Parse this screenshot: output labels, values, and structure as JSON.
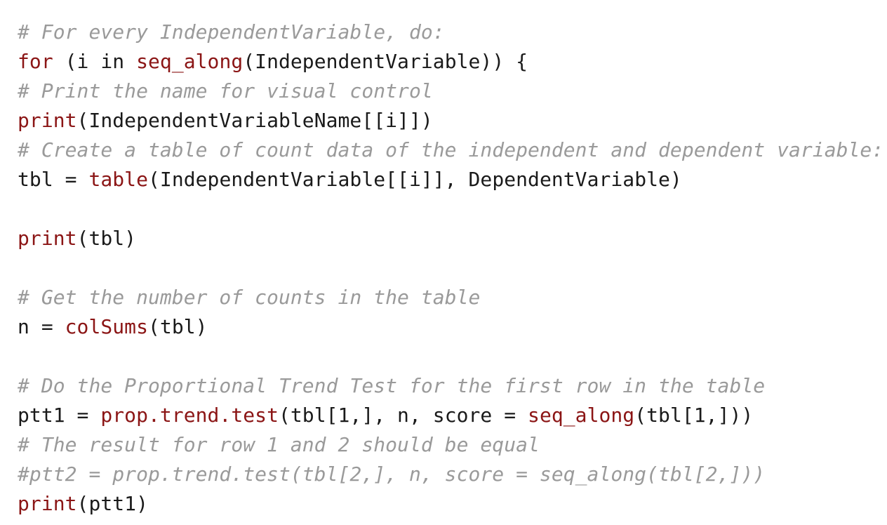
{
  "code": {
    "lines": [
      [
        {
          "t": "# For every IndependentVariable, do:",
          "s": "comment"
        }
      ],
      [
        {
          "t": "for",
          "s": "keyword"
        },
        {
          "t": " (i in ",
          "s": "plain"
        },
        {
          "t": "seq_along",
          "s": "keyword"
        },
        {
          "t": "(IndependentVariable)) {",
          "s": "plain"
        }
      ],
      [
        {
          "t": "# Print the name for visual control",
          "s": "comment"
        }
      ],
      [
        {
          "t": "print",
          "s": "keyword"
        },
        {
          "t": "(IndependentVariableName[[i]])",
          "s": "plain"
        }
      ],
      [
        {
          "t": "# Create a table of count data of the independent and dependent variable:",
          "s": "comment"
        }
      ],
      [
        {
          "t": "tbl = ",
          "s": "plain"
        },
        {
          "t": "table",
          "s": "keyword"
        },
        {
          "t": "(IndependentVariable[[i]], DependentVariable)",
          "s": "plain"
        }
      ],
      [],
      [
        {
          "t": "print",
          "s": "keyword"
        },
        {
          "t": "(tbl)",
          "s": "plain"
        }
      ],
      [],
      [
        {
          "t": "# Get the number of counts in the table",
          "s": "comment"
        }
      ],
      [
        {
          "t": "n = ",
          "s": "plain"
        },
        {
          "t": "colSums",
          "s": "keyword"
        },
        {
          "t": "(tbl)",
          "s": "plain"
        }
      ],
      [],
      [
        {
          "t": "# Do the Proportional Trend Test for the first row in the table",
          "s": "comment"
        }
      ],
      [
        {
          "t": "ptt1 = ",
          "s": "plain"
        },
        {
          "t": "prop.trend.test",
          "s": "keyword"
        },
        {
          "t": "(tbl[1,], n, score = ",
          "s": "plain"
        },
        {
          "t": "seq_along",
          "s": "keyword"
        },
        {
          "t": "(tbl[1,]))",
          "s": "plain"
        }
      ],
      [
        {
          "t": "# The result for row 1 and 2 should be equal",
          "s": "comment"
        }
      ],
      [
        {
          "t": "#ptt2 = prop.trend.test(tbl[2,], n, score = seq_along(tbl[2,]))",
          "s": "comment"
        }
      ],
      [
        {
          "t": "print",
          "s": "keyword"
        },
        {
          "t": "(ptt1)",
          "s": "plain"
        }
      ]
    ]
  },
  "colors": {
    "comment": "#9a9a9a",
    "keyword": "#8b1515",
    "plain": "#1a1a1a",
    "background": "#ffffff"
  }
}
